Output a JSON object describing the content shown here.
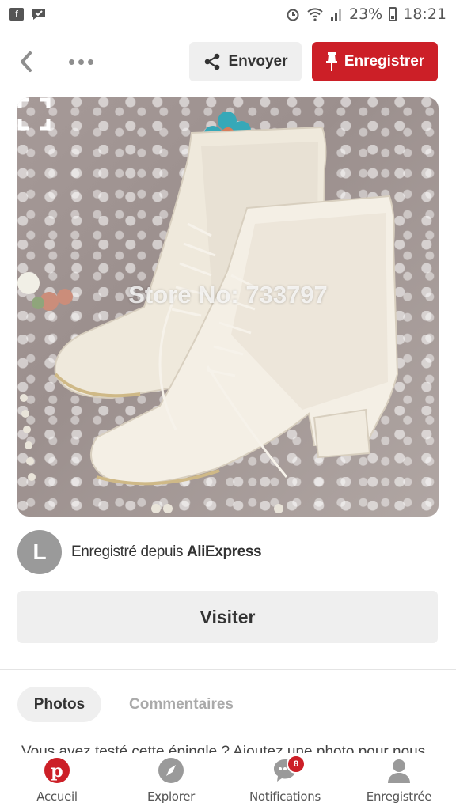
{
  "status_bar": {
    "battery": "23%",
    "time": "18:21",
    "left_icons": [
      "facebook-icon",
      "message-icon"
    ],
    "right_icons": [
      "alarm-icon",
      "wifi-icon",
      "signal-icon",
      "battery-icon"
    ]
  },
  "header": {
    "send_label": "Envoyer",
    "save_label": "Enregistrer",
    "accent_color": "#cc1f27"
  },
  "pin": {
    "watermark": "Store No: 733797"
  },
  "source": {
    "avatar_letter": "L",
    "prefix": "Enregistré depuis ",
    "site": "AliExpress"
  },
  "visit_label": "Visiter",
  "tabs": {
    "photos": "Photos",
    "comments": "Commentaires"
  },
  "prompt": "Vous avez testé cette épingle ? Ajoutez une photo pour nous",
  "bottom_nav": [
    {
      "label": "Accueil",
      "icon": "pinterest-icon",
      "active": true
    },
    {
      "label": "Explorer",
      "icon": "compass-icon",
      "active": false
    },
    {
      "label": "Notifications",
      "icon": "chat-icon",
      "active": false,
      "badge": "8"
    },
    {
      "label": "Enregistrée",
      "icon": "profile-icon",
      "active": false
    }
  ]
}
